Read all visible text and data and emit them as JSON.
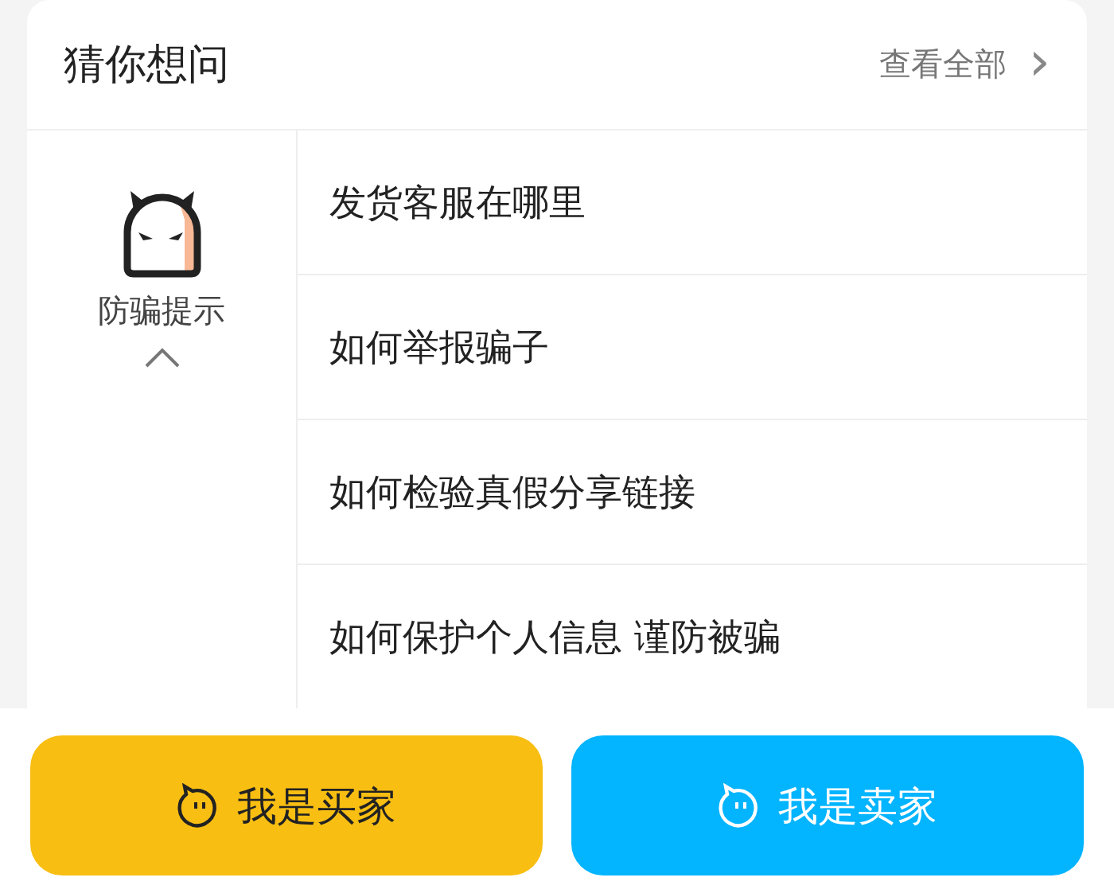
{
  "card": {
    "title": "猜你想问",
    "more_link": "查看全部",
    "more_icon": "›",
    "tip": {
      "label": "防骗提示",
      "expanded": true
    },
    "questions": [
      "发货客服在哪里",
      "如何举报骗子",
      "如何检验真假分享链接",
      "如何保护个人信息 谨防被骗"
    ]
  },
  "buttons": [
    {
      "label": "我是买家",
      "kind": "buyer"
    },
    {
      "label": "我是卖家",
      "kind": "seller"
    }
  ]
}
